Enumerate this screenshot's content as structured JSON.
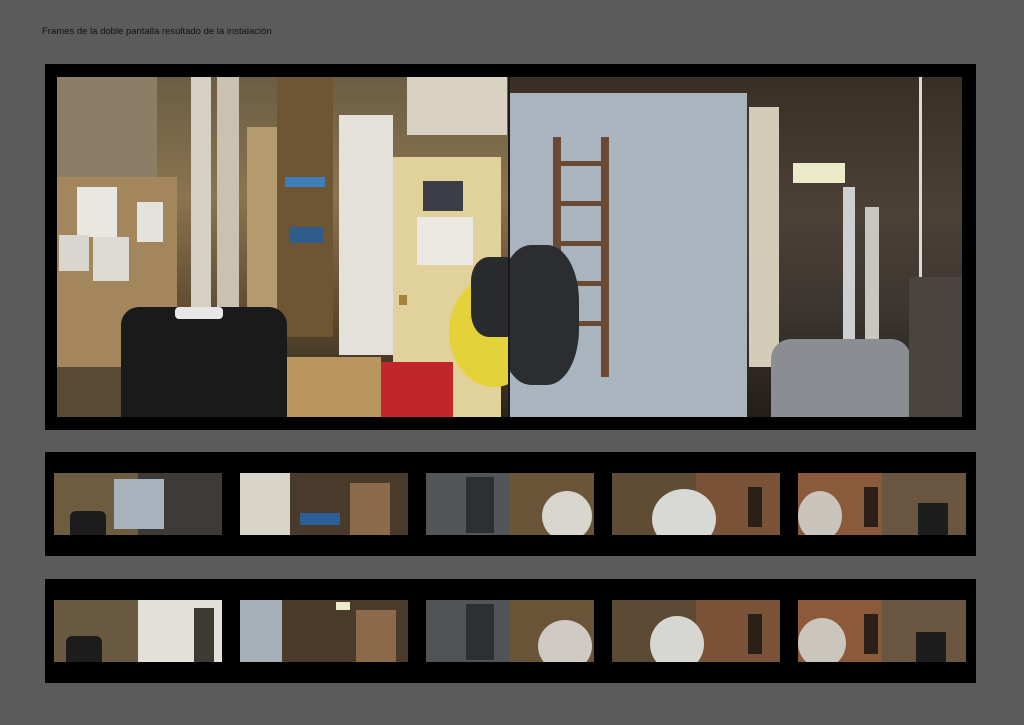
{
  "caption": "Frames de la doble pantalla resultado de la instalación",
  "main_frame": {
    "left_view": "workshop-left",
    "right_view": "workshop-right"
  },
  "strips": [
    {
      "thumbs": [
        {
          "a": "#6d5c40",
          "b": "#3e3a37",
          "accent": "#a9b3bd"
        },
        {
          "a": "#d8d4c8",
          "b": "#4a3a2c",
          "accent": "#8a6c4c"
        },
        {
          "a": "#525658",
          "b": "#6b5538",
          "accent": "#d9d6d0"
        },
        {
          "a": "#5e4c35",
          "b": "#7a5238",
          "accent": "#d8d8d4"
        },
        {
          "a": "#8a5a3a",
          "b": "#6a5640",
          "accent": "#c9c5bd"
        }
      ]
    },
    {
      "thumbs": [
        {
          "a": "#6a5a42",
          "b": "#e2e0d8",
          "accent": "#3d3a36"
        },
        {
          "a": "#a7b0b8",
          "b": "#4a3a2a",
          "accent": "#8a6a48"
        },
        {
          "a": "#505456",
          "b": "#6a5438",
          "accent": "#cfcbc4"
        },
        {
          "a": "#5c4a34",
          "b": "#7a5238",
          "accent": "#d6d6d2"
        },
        {
          "a": "#8c5a3a",
          "b": "#6a5640",
          "accent": "#cac6be"
        }
      ]
    }
  ]
}
